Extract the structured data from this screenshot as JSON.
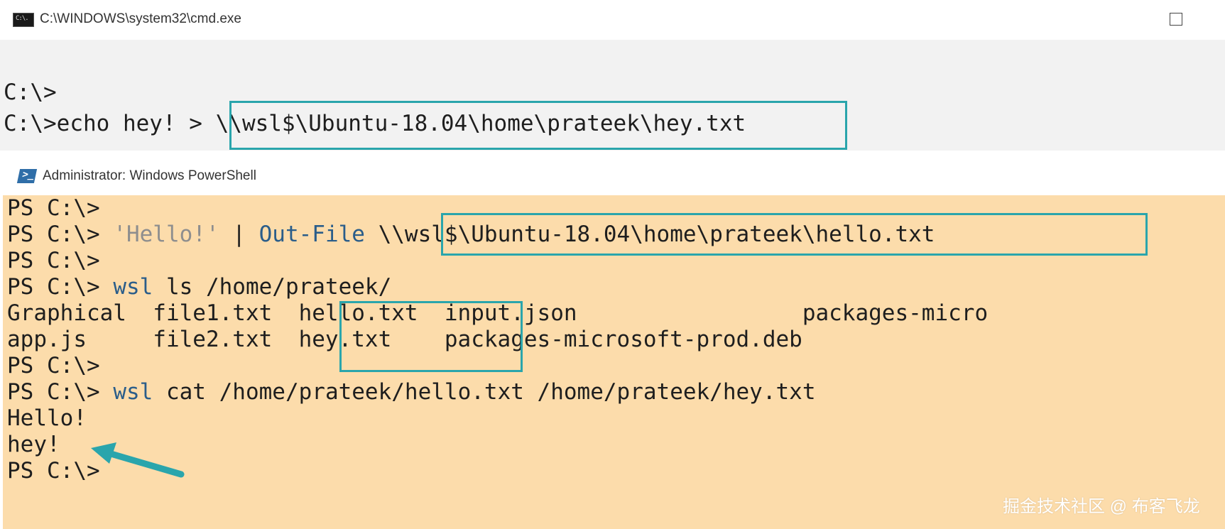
{
  "cmd": {
    "title": "C:\\WINDOWS\\system32\\cmd.exe",
    "icon_label": "C:\\.",
    "lines": [
      "C:\\>",
      "C:\\>echo hey! > \\\\wsl$\\Ubuntu-18.04\\home\\prateek\\hey.txt"
    ]
  },
  "powershell": {
    "title": "Administrator: Windows PowerShell",
    "icon_label": ">_",
    "prompt": "PS C:\\>",
    "line2": {
      "prompt": "PS C:\\> ",
      "string": "'Hello!'",
      "pipe": " | ",
      "cmdlet": "Out-File",
      "path": " \\\\wsl$\\Ubuntu-18.04\\home\\prateek\\hello.txt"
    },
    "line4": {
      "prompt": "PS C:\\> ",
      "cmd": "wsl",
      "args": " ls /home/prateek/"
    },
    "ls_row1": "Graphical  file1.txt  hello.txt  input.json                 packages-micro",
    "ls_row2": "app.js     file2.txt  hey.txt    packages-microsoft-prod.deb",
    "line8": {
      "prompt": "PS C:\\> ",
      "cmd": "wsl",
      "args": " cat /home/prateek/hello.txt /home/prateek/hey.txt"
    },
    "output1": "Hello!",
    "output2": "hey!"
  },
  "colors": {
    "highlight": "#2aa5ac",
    "ps_background": "#fcdcab",
    "cmd_background": "#f2f2f2",
    "ps_command": "#2a5d8a",
    "ps_string": "#8e8e8e"
  },
  "watermark": "掘金技术社区 @ 布客飞龙"
}
